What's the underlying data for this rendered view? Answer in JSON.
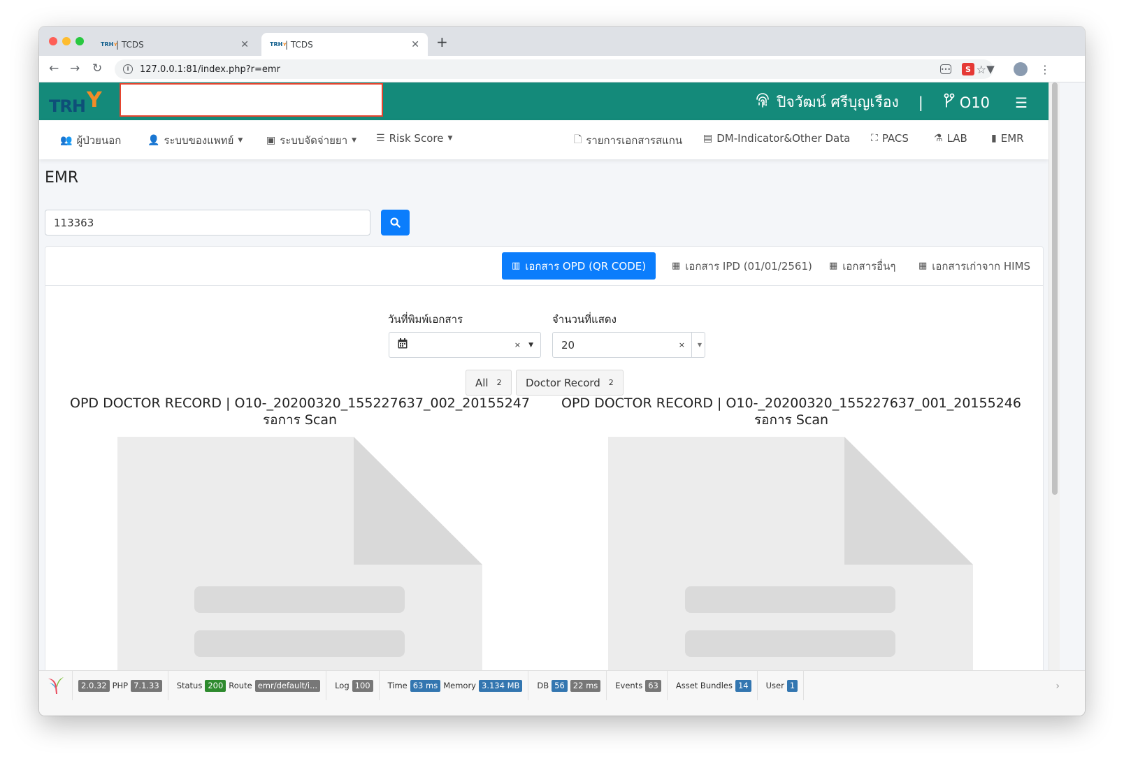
{
  "browser": {
    "tabs": [
      {
        "favicon": "TRH",
        "title": "| TCDS",
        "close": "✕"
      },
      {
        "favicon": "TRH",
        "title": "| TCDS",
        "close": "✕"
      }
    ],
    "new_tab": "+",
    "url": "127.0.0.1:81/index.php?r=emr"
  },
  "header": {
    "logo_text": "TRH",
    "user_name": "ปิจวัฒน์ ศรีบุญเรือง",
    "separator": "|",
    "branch_code": "O10"
  },
  "navbar": {
    "items": [
      {
        "label": "ผู้ป่วยนอก",
        "icon": "users-icon"
      },
      {
        "label": "ระบบของแพทย์",
        "icon": "doctor-icon"
      },
      {
        "label": "ระบบจัดจ่ายยา",
        "icon": "medkit-icon"
      },
      {
        "label": "Risk Score",
        "icon": "sliders-icon"
      },
      {
        "label": "รายการเอกสารสแกน",
        "icon": "file-icon"
      },
      {
        "label": "DM-Indicator&Other Data",
        "icon": "clipboard-icon"
      },
      {
        "label": "PACS",
        "icon": "expand-icon"
      },
      {
        "label": "LAB",
        "icon": "flask-icon"
      },
      {
        "label": "EMR",
        "icon": "book-icon"
      }
    ]
  },
  "main": {
    "title": "EMR",
    "search_value": "113363",
    "doc_tabs": [
      {
        "label": "เอกสาร OPD (QR CODE)",
        "active": true
      },
      {
        "label": "เอกสาร IPD (01/01/2561)",
        "active": false
      },
      {
        "label": "เอกสารอื่นๆ",
        "active": false
      },
      {
        "label": "เอกสารเก่าจาก HIMS",
        "active": false
      }
    ],
    "filters": {
      "date_label": "วันที่พิมพ์เอกสาร",
      "date_value": "",
      "count_label": "จำนวนที่แสดง",
      "count_value": "20"
    },
    "pills": [
      {
        "label": "All",
        "count": "2"
      },
      {
        "label": "Doctor Record",
        "count": "2"
      }
    ],
    "documents": [
      {
        "title": "OPD DOCTOR RECORD | O10-_20200320_155227637_002_20155247 รอการ Scan"
      },
      {
        "title": "OPD DOCTOR RECORD | O10-_20200320_155227637_001_20155246 รอการ Scan"
      }
    ]
  },
  "debug": {
    "yii_version": "2.0.32",
    "php_label": "PHP",
    "php_version": "7.1.33",
    "status_label": "Status",
    "status": "200",
    "route_label": "Route",
    "route": "emr/default/i...",
    "log_label": "Log",
    "log": "100",
    "time_label": "Time",
    "time": "63 ms",
    "memory_label": "Memory",
    "memory": "3.134 MB",
    "db_label": "DB",
    "db_count": "56",
    "db_time": "22 ms",
    "events_label": "Events",
    "events": "63",
    "assets_label": "Asset Bundles",
    "assets": "14",
    "user_label": "User",
    "user": "1"
  },
  "colors": {
    "header_bg": "#148a7a",
    "primary": "#0b7dfc",
    "redaction_border": "#e5452f"
  }
}
